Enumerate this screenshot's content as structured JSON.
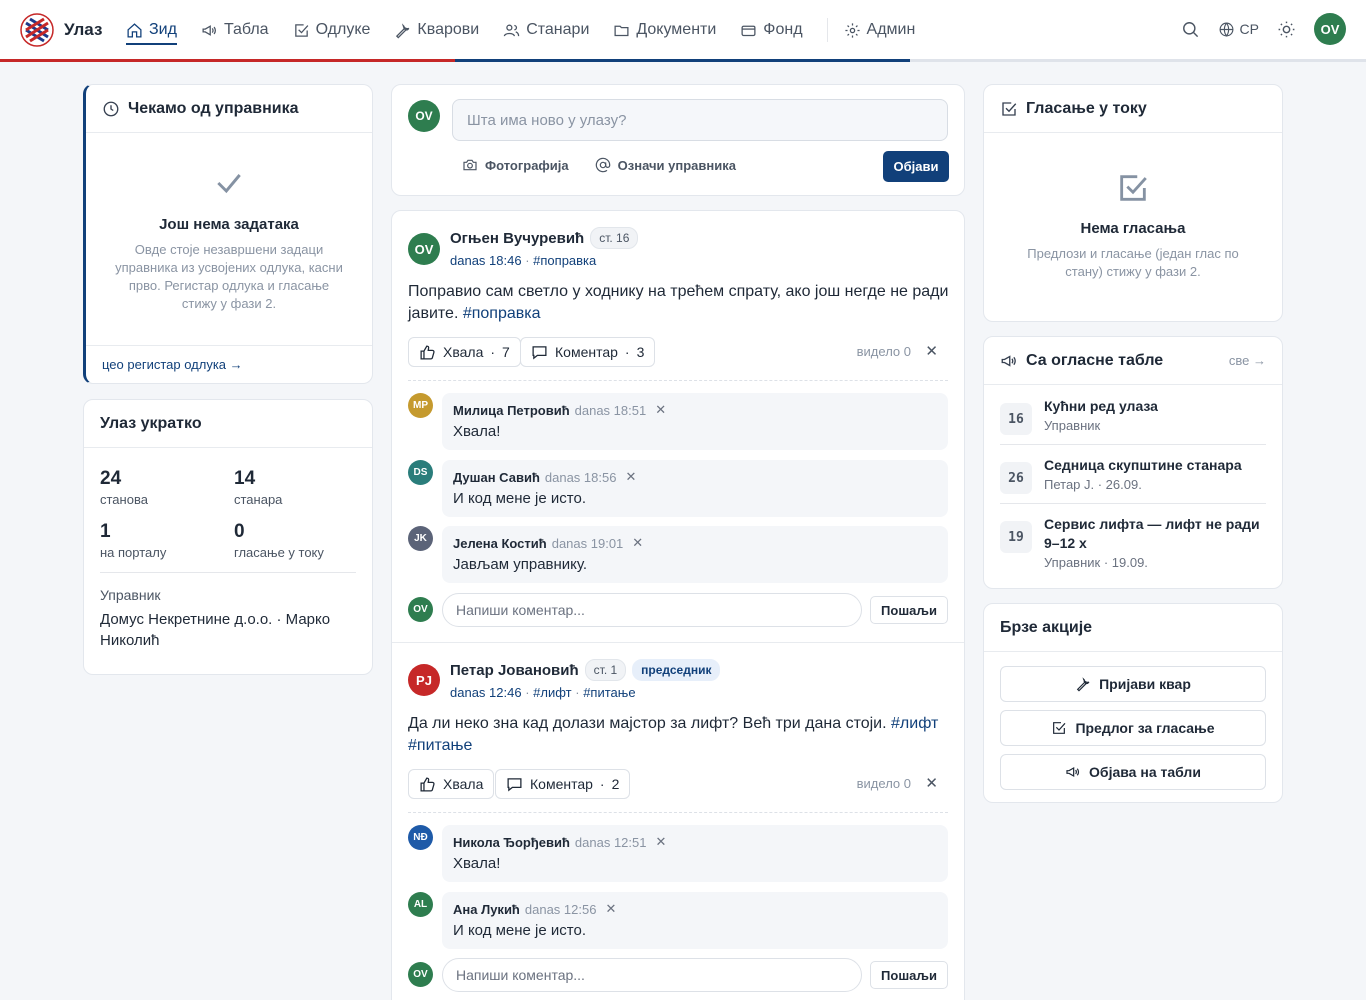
{
  "brand": {
    "name": "Улаз",
    "logo_colors": [
      "#c62828",
      "#1e3a8a",
      "#ffffff"
    ]
  },
  "nav": {
    "items": [
      {
        "label": "Зид",
        "icon": "home-icon",
        "active": true
      },
      {
        "label": "Табла",
        "icon": "megaphone-icon"
      },
      {
        "label": "Одлуке",
        "icon": "check-square-icon"
      },
      {
        "label": "Кварови",
        "icon": "wrench-icon"
      },
      {
        "label": "Станари",
        "icon": "users-icon"
      },
      {
        "label": "Документи",
        "icon": "folder-icon"
      },
      {
        "label": "Фонд",
        "icon": "wallet-icon"
      },
      {
        "label": "Админ",
        "icon": "gear-icon"
      }
    ]
  },
  "topbar": {
    "lang": "СР",
    "user_initials": "OV",
    "stripe_colors": [
      "#c62828",
      "#11407a",
      "#ffffff"
    ]
  },
  "pending": {
    "title": "Чекамо од управника",
    "empty_title": "Још нема задатака",
    "empty_text": "Овде стоје незавршени задаци управника из усвојених одлука, касни прво. Регистар одлука и гласање стижу у фази 2.",
    "footer_link": "цео регистар одлука →"
  },
  "summary": {
    "title": "Улаз укратко",
    "stats": [
      {
        "value": "24",
        "label": "станова"
      },
      {
        "value": "14",
        "label": "станара"
      },
      {
        "value": "1",
        "label": "на порталу"
      },
      {
        "value": "0",
        "label": "гласање у току"
      }
    ],
    "manager_label": "Управник",
    "manager_value": "Домус Некретнине д.о.о. · Марко Николић"
  },
  "composer": {
    "avatar": "OV",
    "placeholder": "Шта има ново у улазу?",
    "photo_label": "Фотографија",
    "mention_label": "Означи управника",
    "publish_label": "Објави"
  },
  "posts": [
    {
      "avatar": "OV",
      "avatar_color": "#2e7d4f",
      "author": "Огњен Вучуревић",
      "apt": "ст. 16",
      "role": "",
      "time": "danas 18:46",
      "tags": [
        "#поправка"
      ],
      "text": "Поправио сам светло у ходнику на трећем спрату, ако још негде не ради јавите.",
      "text_tags": "#поправка",
      "like_label": "Хвала",
      "like_count": "7",
      "comment_label": "Коментар",
      "comment_count": "3",
      "seen": "видело 0",
      "comments": [
        {
          "avatar": "MP",
          "color": "#c59a2e",
          "author": "Милица Петровић",
          "time": "danas 18:51",
          "text": "Хвала!"
        },
        {
          "avatar": "DS",
          "color": "#2a7d7b",
          "author": "Душан Савић",
          "time": "danas 18:56",
          "text": "И код мене је исто."
        },
        {
          "avatar": "JK",
          "color": "#5b6378",
          "author": "Јелена Костић",
          "time": "danas 19:01",
          "text": "Јављам управнику."
        }
      ],
      "comment_placeholder": "Напиши коментар...",
      "send_label": "Пошаљи"
    },
    {
      "avatar": "PJ",
      "avatar_color": "#c62828",
      "author": "Петар Јовановић",
      "apt": "ст. 1",
      "role": "председник",
      "time": "danas 12:46",
      "tags": [
        "#лифт",
        "#питање"
      ],
      "text": "Да ли неко зна кад долази мајстор за лифт? Већ три дана стоји.",
      "text_tags": "#лифт #питање",
      "like_label": "Хвала",
      "like_count": "",
      "comment_label": "Коментар",
      "comment_count": "2",
      "seen": "видело 0",
      "comments": [
        {
          "avatar": "NĐ",
          "color": "#1e5aa8",
          "author": "Никола Ђорђевић",
          "time": "danas 12:51",
          "text": "Хвала!"
        },
        {
          "avatar": "AL",
          "color": "#2e7d4f",
          "author": "Ана Лукић",
          "time": "danas 12:56",
          "text": "И код мене је исто."
        }
      ],
      "comment_placeholder": "Напиши коментар...",
      "send_label": "Пошаљи"
    }
  ],
  "votes": {
    "title": "Гласање у току",
    "empty_title": "Нема гласања",
    "empty_text": "Предлози и гласање (један глас по стану) стижу у фази 2."
  },
  "board": {
    "title": "Са огласне табле",
    "all_label": "све →",
    "items": [
      {
        "day": "16",
        "title": "Кућни ред улаза",
        "sub": "Управник"
      },
      {
        "day": "26",
        "title": "Седница скупштине станара",
        "sub": "Петар Ј. · 26.09."
      },
      {
        "day": "19",
        "title": "Сервис лифта — лифт не ради 9–12 х",
        "sub": "Управник · 19.09."
      }
    ]
  },
  "quick": {
    "title": "Брзе акције",
    "buttons": [
      {
        "label": "Пријави квар",
        "icon": "wrench-icon"
      },
      {
        "label": "Предлог за гласање",
        "icon": "check-square-icon"
      },
      {
        "label": "Објава на табли",
        "icon": "megaphone-icon"
      }
    ]
  },
  "colors": {
    "accent": "#11407a",
    "brand_red": "#c62828",
    "bg": "#f4f6f9"
  }
}
